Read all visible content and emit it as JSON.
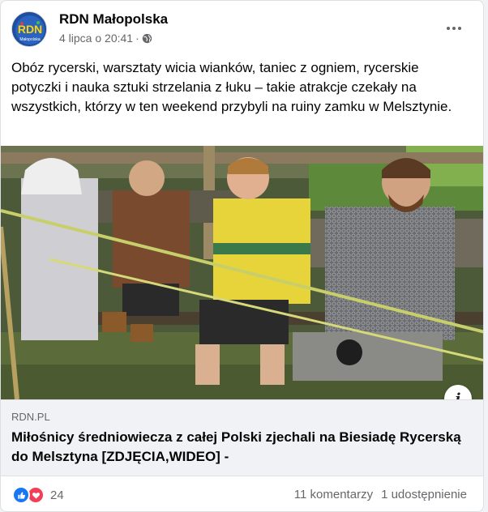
{
  "post": {
    "page_name": "RDN Małopolska",
    "date": "4 lipca o 20:41",
    "separator": "·",
    "text": "Obóz rycerski, warsztaty wicia wianków, taniec z ogniem, rycerskie potyczki i nauka sztuki strzelania z łuku – takie atrakcje czekały na wszystkich, którzy w ten weekend przybyli na ruiny zamku w Melsztynie."
  },
  "avatar": {
    "logo_text": "RDN",
    "logo_subtext": "Małopolska",
    "bg_color": "#1f4e9e"
  },
  "link": {
    "domain": "RDN.PL",
    "title": "Miłośnicy średniowiecza z całej Polski zjechali na Biesiadę Rycerską do Melsztyna [ZDJĘCIA,WIDEO] -"
  },
  "footer": {
    "reaction_count": "24",
    "comments": "11 komentarzy",
    "shares": "1 udostępnienie"
  },
  "icons": {
    "privacy": "globe-icon",
    "more": "more-options-icon",
    "info": "info-icon",
    "like": "like-reaction-icon",
    "love": "love-reaction-icon"
  },
  "colors": {
    "like": "#1877f2",
    "love": "#f33e58",
    "secondary_text": "#65676b"
  }
}
